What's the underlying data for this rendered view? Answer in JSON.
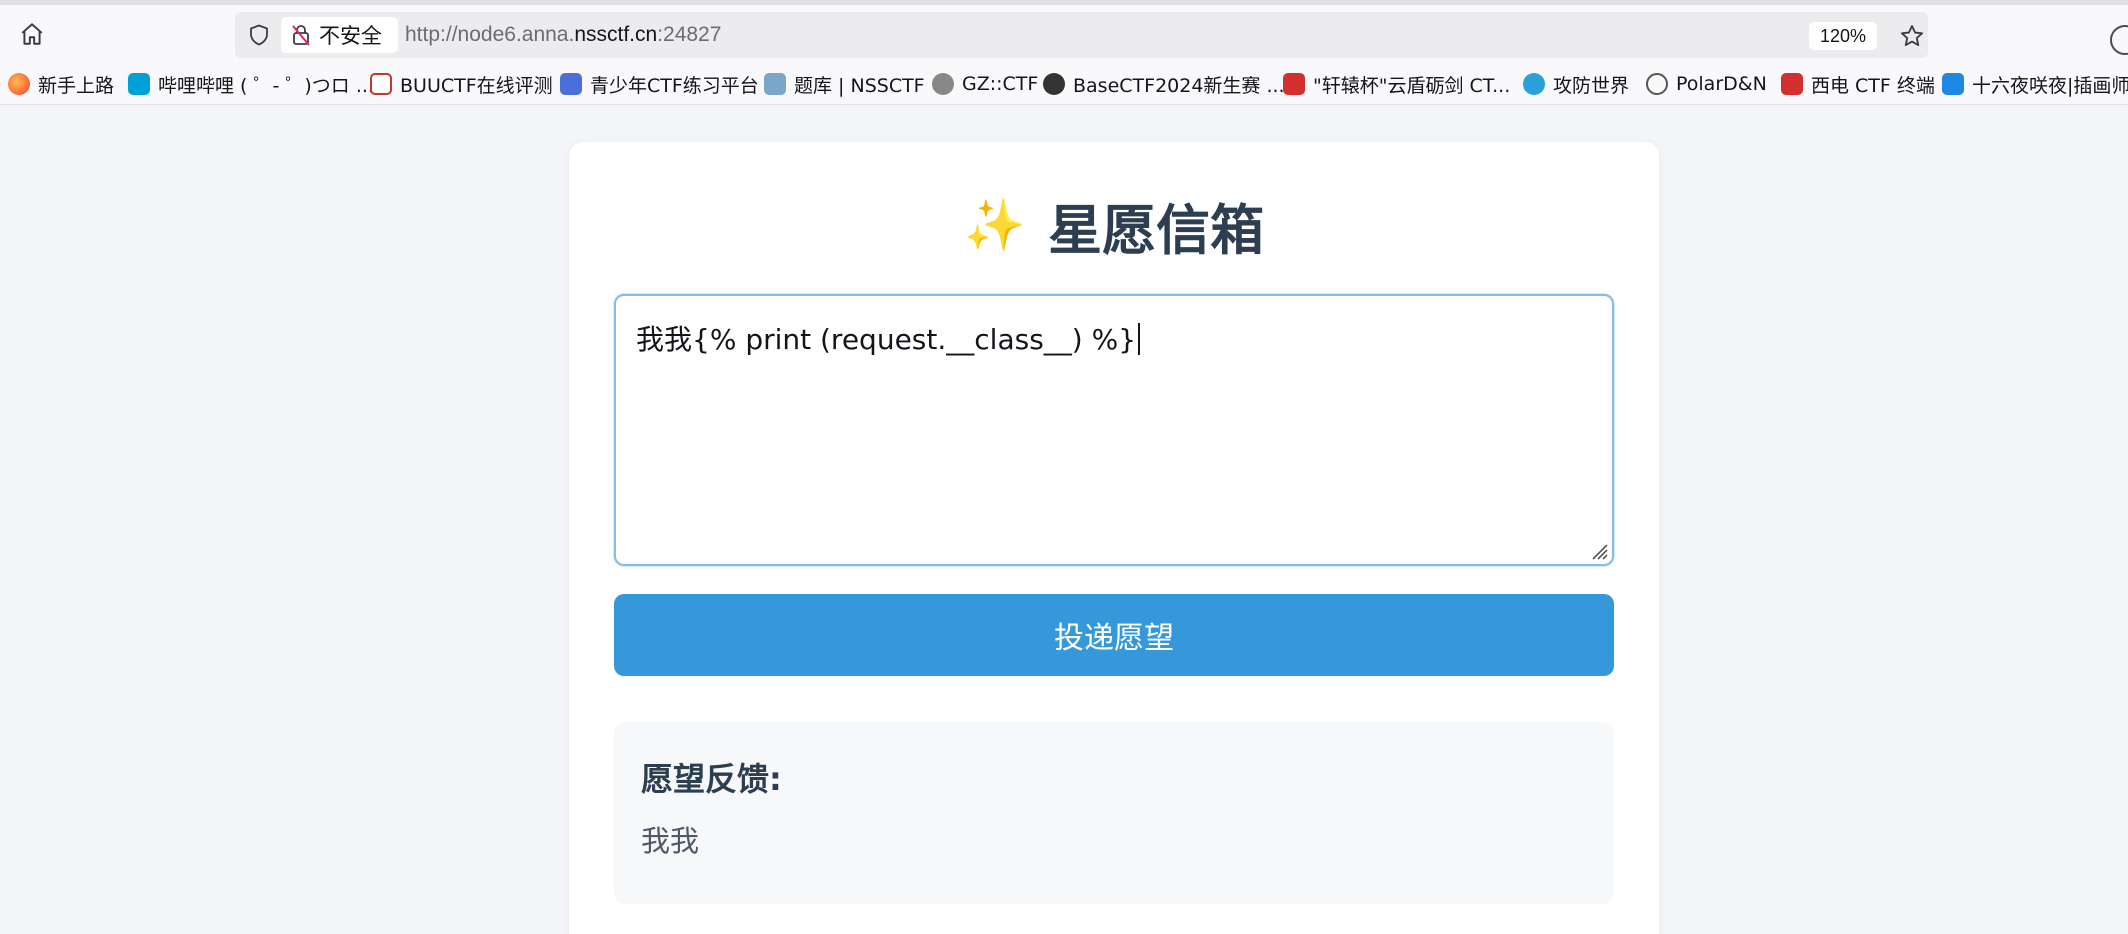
{
  "browser": {
    "security_label": "不安全",
    "url_prefix": "http://node6.anna.",
    "url_domain": "nssctf.cn",
    "url_port": ":24827",
    "zoom": "120%",
    "bookmarks": [
      {
        "label": "新手上路",
        "icon": "firefox-icon",
        "color": "#ff7139"
      },
      {
        "label": "哔哩哔哩 ( ゜- ゜)つロ ...",
        "icon": "bilibili-icon",
        "color": "#00a1d6"
      },
      {
        "label": "BUUCTF在线评测",
        "icon": "buuctf-icon",
        "color": "#c0392b"
      },
      {
        "label": "青少年CTF练习平台",
        "icon": "qsnctf-icon",
        "color": "#4a6fd8"
      },
      {
        "label": "题库 | NSSCTF",
        "icon": "nssctf-icon",
        "color": "#7aa6c8"
      },
      {
        "label": "GZ::CTF",
        "icon": "gzctf-icon",
        "color": "#666666"
      },
      {
        "label": "BaseCTF2024新生赛 ...",
        "icon": "basectf-icon",
        "color": "#333333"
      },
      {
        "label": "\"轩辕杯\"云盾砺剑 CT...",
        "icon": "xuanyuan-icon",
        "color": "#d32f2f"
      },
      {
        "label": "攻防世界",
        "icon": "adworld-icon",
        "color": "#29a0d8"
      },
      {
        "label": "PolarD&N",
        "icon": "globe-icon",
        "color": "#555555"
      },
      {
        "label": "西电 CTF 终端",
        "icon": "xidian-icon",
        "color": "#d32f2f"
      },
      {
        "label": "十六夜咲夜|插画师",
        "icon": "bing-icon",
        "color": "#1e88e5"
      }
    ]
  },
  "page": {
    "title_icon": "✨",
    "title": "星愿信箱",
    "wish_input_value": "我我{% print (request.__class__) %}",
    "submit_label": "投递愿望",
    "feedback_title": "愿望反馈:",
    "feedback_text": "我我"
  },
  "colors": {
    "accent": "#3498db",
    "heading": "#2c3e50"
  }
}
